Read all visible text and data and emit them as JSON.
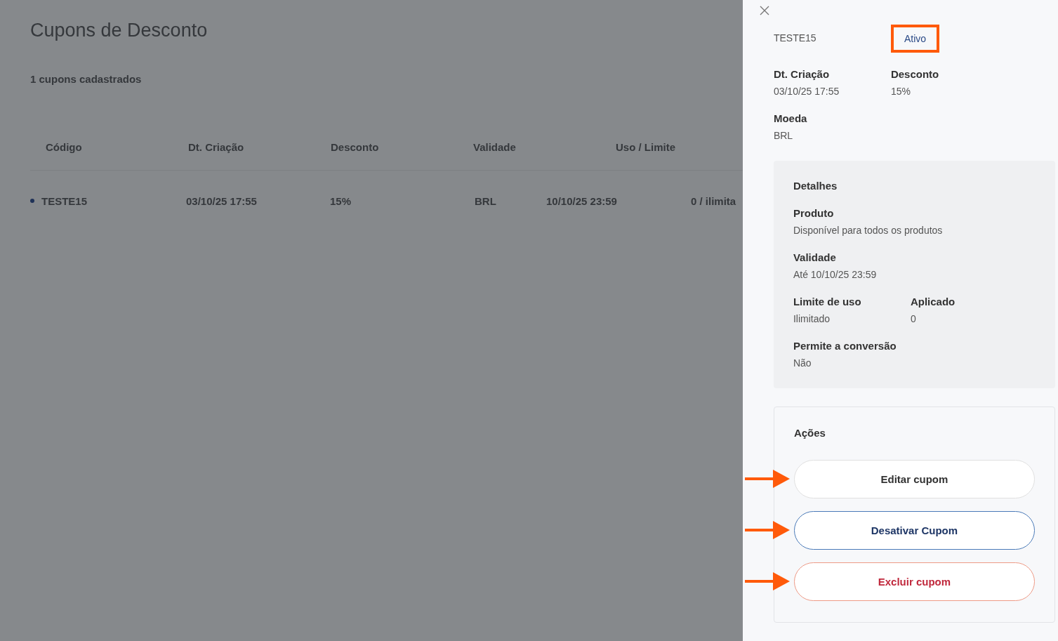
{
  "page": {
    "title": "Cupons de Desconto",
    "count": "1 cupons cadastrados"
  },
  "table": {
    "columns": [
      "Código",
      "Dt. Criação",
      "Desconto",
      "Validade",
      "Uso / Limite"
    ],
    "rows": [
      {
        "cells": [
          "TESTE15",
          "03/10/25 17:55",
          "15%",
          "BRL",
          "10/10/25 23:59",
          "0 / ilimita"
        ]
      }
    ]
  },
  "drawer": {
    "code": "TESTE15",
    "status": {
      "label": "Ativo",
      "highlighted": true
    },
    "fields": [
      [
        {
          "label": "Dt. Criação",
          "value": "03/10/25 17:55"
        },
        {
          "label": "Desconto",
          "value": "15%"
        }
      ],
      [
        {
          "label": "Moeda",
          "value": "BRL"
        }
      ]
    ],
    "details": {
      "title": "Detalhes",
      "fields": [
        [
          {
            "label": "Produto",
            "value": "Disponível para todos os produtos"
          }
        ],
        [
          {
            "label": "Validade",
            "value": "Até 10/10/25 23:59"
          }
        ],
        [
          {
            "label": "Limite de uso",
            "value": "Ilimitado"
          },
          {
            "label": "Aplicado",
            "value": "0"
          }
        ],
        [
          {
            "label": "Permite a conversão",
            "value": "Não"
          }
        ]
      ]
    },
    "actions": {
      "title": "Ações",
      "buttons": [
        {
          "label": "Editar cupom",
          "kind": "neutral",
          "annotated": true
        },
        {
          "label": "Desativar Cupom",
          "kind": "primary",
          "annotated": true
        },
        {
          "label": "Excluir cupom",
          "kind": "danger",
          "annotated": true
        }
      ]
    }
  }
}
